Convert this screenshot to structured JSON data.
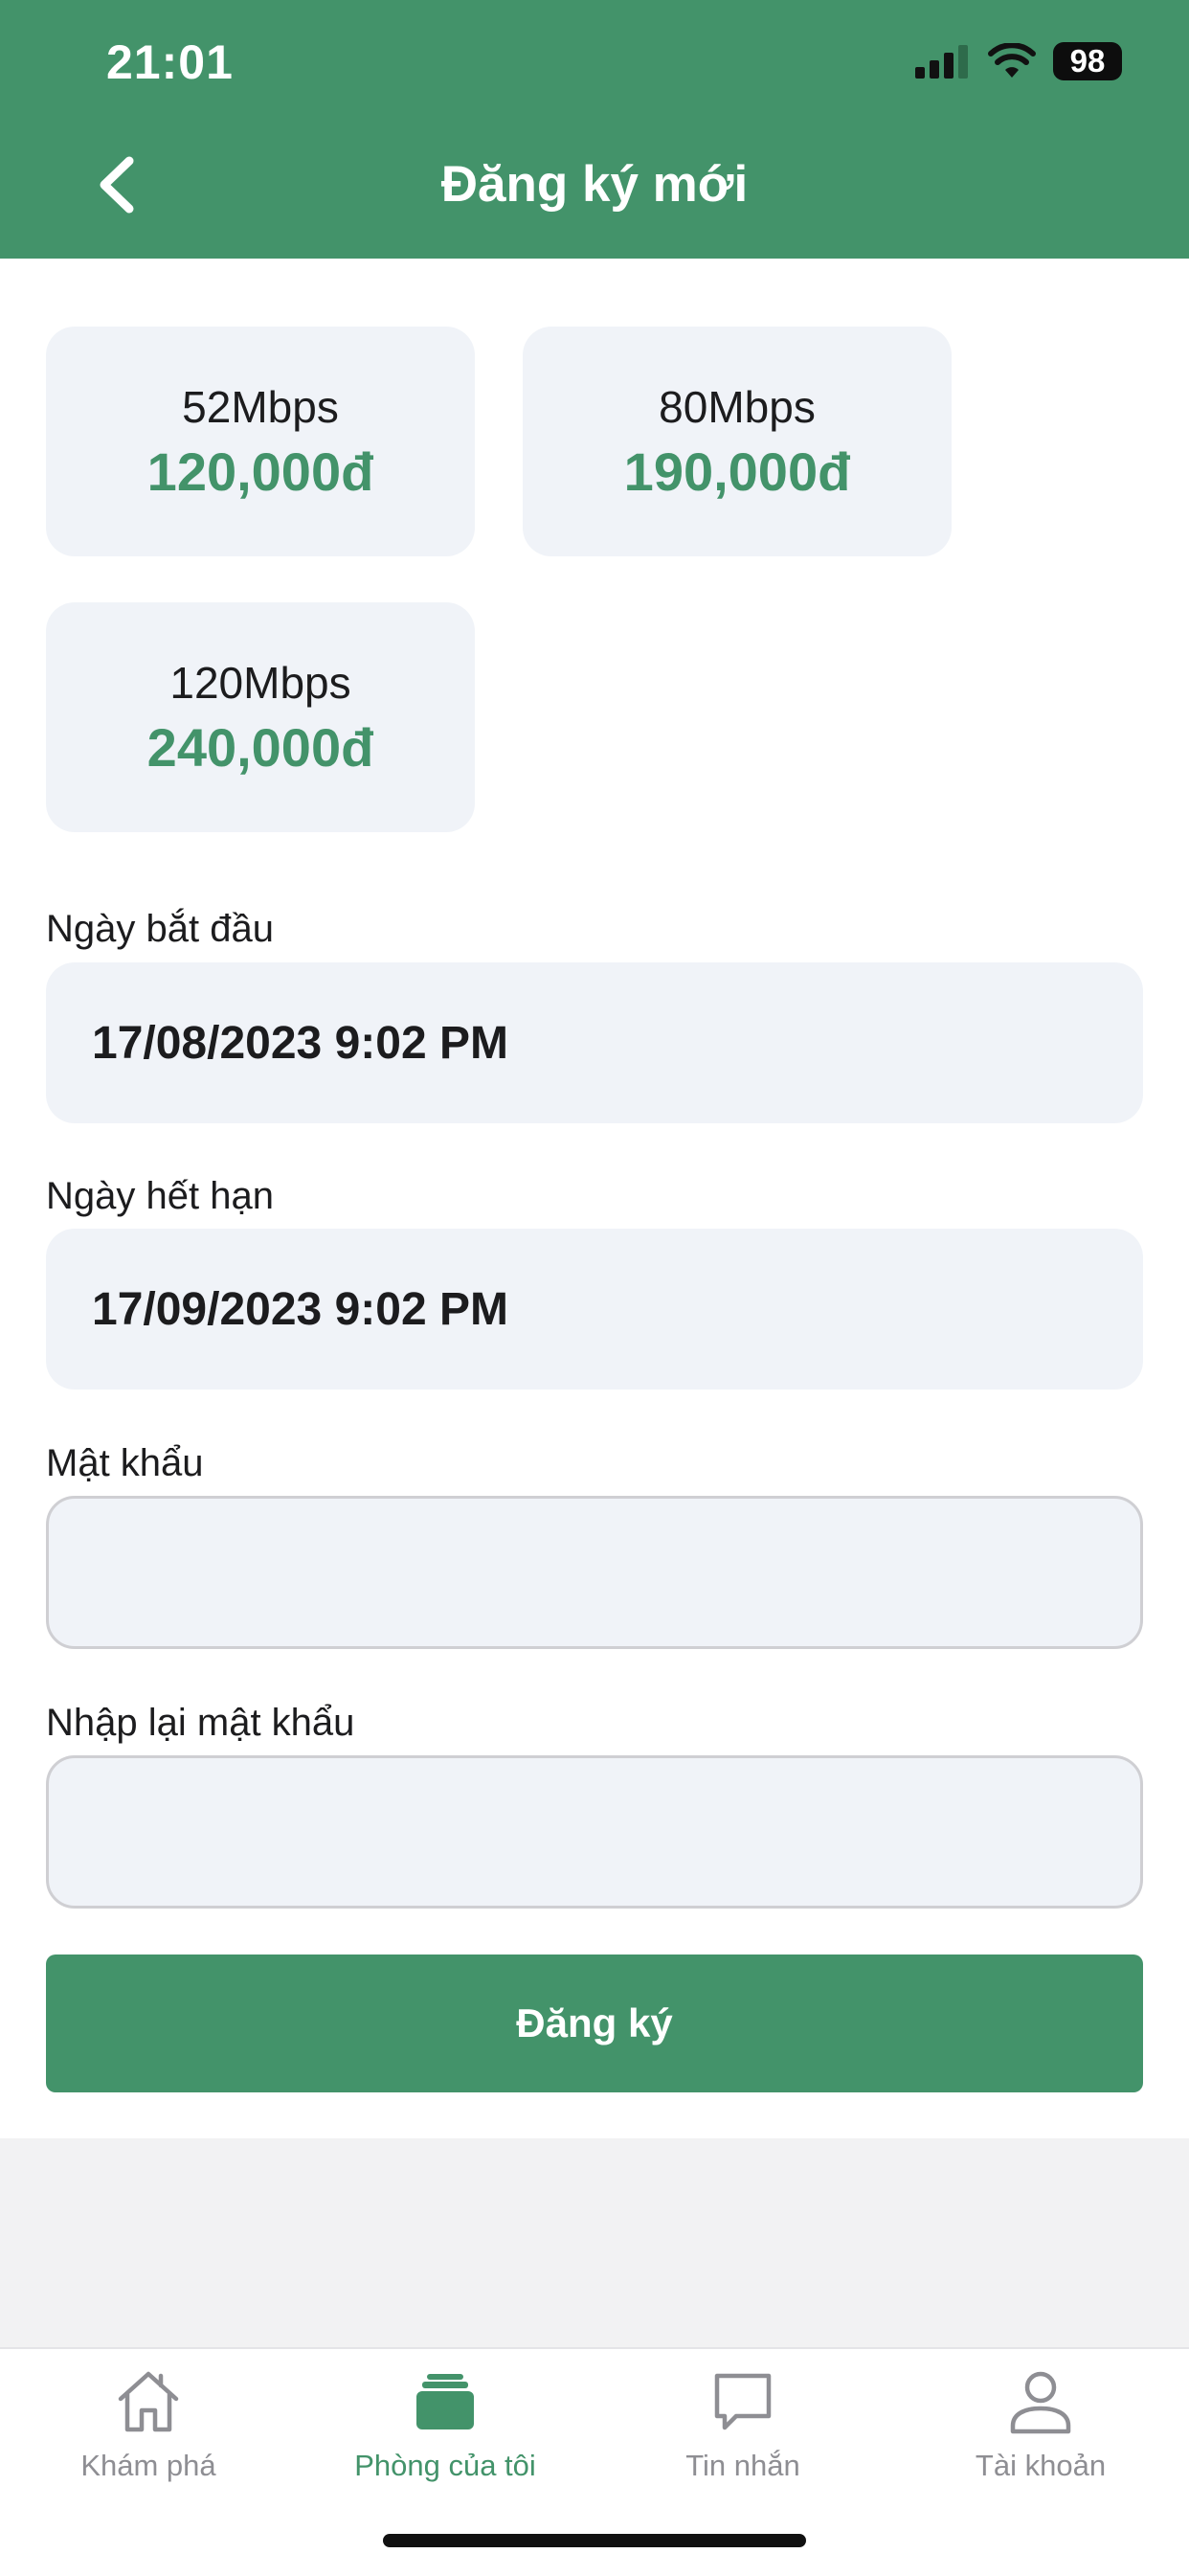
{
  "status_bar": {
    "time": "21:01",
    "battery": "98"
  },
  "header": {
    "title": "Đăng ký mới",
    "back_icon": "chevron-left-icon"
  },
  "plans": [
    {
      "speed": "52Mbps",
      "price": "120,000đ"
    },
    {
      "speed": "80Mbps",
      "price": "190,000đ"
    },
    {
      "speed": "120Mbps",
      "price": "240,000đ"
    }
  ],
  "form": {
    "start_label": "Ngày bắt đầu",
    "start_value": "17/08/2023 9:02 PM",
    "end_label": "Ngày hết hạn",
    "end_value": "17/09/2023 9:02 PM",
    "password_label": "Mật khẩu",
    "password_value": "",
    "confirm_label": "Nhập lại mật khẩu",
    "confirm_value": "",
    "submit_label": "Đăng ký"
  },
  "tabbar": {
    "items": [
      {
        "label": "Khám phá",
        "icon": "home-icon"
      },
      {
        "label": "Phòng của tôi",
        "icon": "room-stack-icon",
        "active": true
      },
      {
        "label": "Tin nhắn",
        "icon": "chat-bubble-icon"
      },
      {
        "label": "Tài khoản",
        "icon": "user-icon"
      }
    ]
  },
  "colors": {
    "accent": "#43936a",
    "card_bg": "#f0f3f8"
  }
}
